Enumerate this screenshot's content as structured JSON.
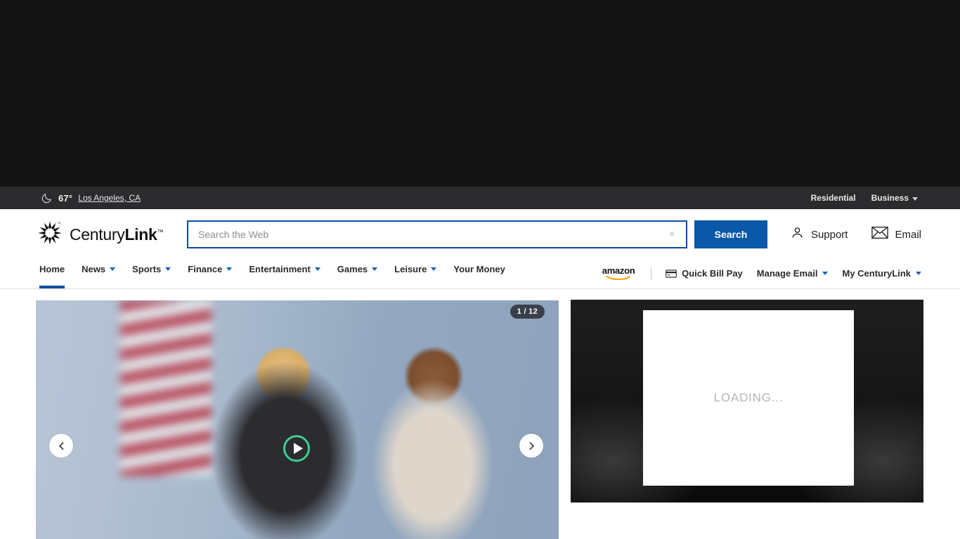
{
  "top_slot": {
    "name": "top-ad-slot"
  },
  "utility_bar": {
    "weather_icon": "crescent-moon-icon",
    "temperature": "67°",
    "location": "Los Angeles, CA",
    "links": [
      {
        "label": "Residential",
        "has_caret": false
      },
      {
        "label": "Business",
        "has_caret": true
      }
    ]
  },
  "header": {
    "logo": {
      "icon": "centurylink-starburst-icon",
      "text_light": "Century",
      "text_bold": "Link",
      "tm": "™"
    },
    "search": {
      "placeholder": "Search the Web",
      "value": "",
      "clear_icon": "×",
      "button_label": "Search"
    },
    "right_items": [
      {
        "icon": "person-icon",
        "label": "Support"
      },
      {
        "icon": "envelope-icon",
        "label": "Email"
      }
    ]
  },
  "nav": {
    "left_items": [
      {
        "label": "Home",
        "caret": false,
        "active": true
      },
      {
        "label": "News",
        "caret": true,
        "active": false
      },
      {
        "label": "Sports",
        "caret": true,
        "active": false
      },
      {
        "label": "Finance",
        "caret": true,
        "active": false
      },
      {
        "label": "Entertainment",
        "caret": true,
        "active": false
      },
      {
        "label": "Games",
        "caret": true,
        "active": false
      },
      {
        "label": "Leisure",
        "caret": true,
        "active": false
      },
      {
        "label": "Your Money",
        "caret": false,
        "active": false
      }
    ],
    "amazon_label": "amazon",
    "right_items": [
      {
        "label": "Quick Bill Pay",
        "icon": "credit-card-icon",
        "caret": false
      },
      {
        "label": "Manage Email",
        "icon": "",
        "caret": true
      },
      {
        "label": "My CenturyLink",
        "icon": "",
        "caret": true
      }
    ]
  },
  "main": {
    "carousel": {
      "counter": "1 / 12",
      "prev_icon": "chevron-left-icon",
      "next_icon": "chevron-right-icon",
      "play_icon": "play-icon"
    },
    "ad": {
      "loading_text": "LOADING..."
    }
  },
  "colors": {
    "brand_blue": "#0b4da2",
    "search_button": "#0b57a8",
    "utility_bar": "#2b2b2e",
    "play_ring": "#3ecf8e",
    "amazon_orange": "#f90"
  }
}
